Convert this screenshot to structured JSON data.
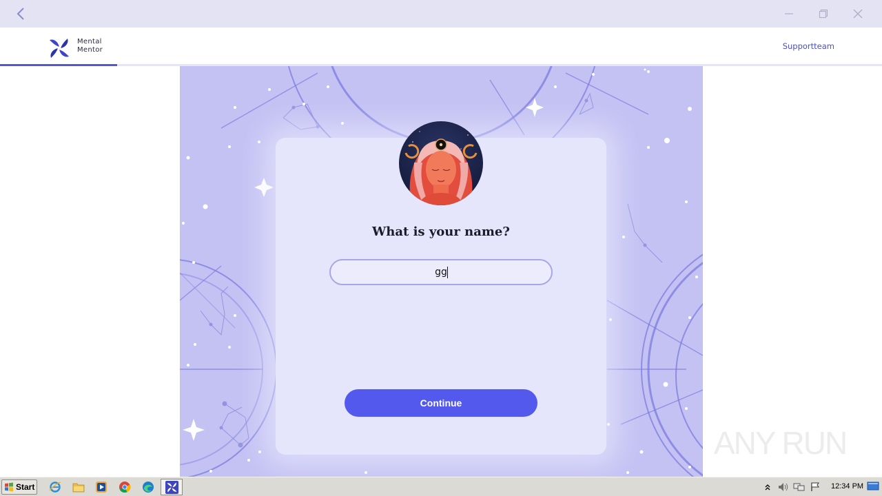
{
  "window": {
    "icons": {
      "back": "chevron-left-icon",
      "minimize": "minimize-icon",
      "restore": "restore-icon",
      "close": "close-icon"
    }
  },
  "header": {
    "brand_line1": "Mental",
    "brand_line2": "Mentor",
    "support_label": "Supportteam",
    "progress_fraction": 0.133,
    "accent_color": "#5457d1"
  },
  "onboarding": {
    "question": "What is your name?",
    "name_value": "gg",
    "continue_label": "Continue",
    "button_color": "#5459ee",
    "background_color": "#c4c2f3",
    "card_color": "#e5e5fb"
  },
  "watermark": {
    "text": "ANY RUN"
  },
  "taskbar": {
    "start_label": "Start",
    "pinned": [
      "internet-explorer-icon",
      "file-explorer-icon",
      "media-player-icon",
      "chrome-icon",
      "edge-icon",
      "mental-mentor-app-icon"
    ],
    "tray": [
      "show-hidden-icons-icon",
      "volume-icon",
      "network-icon",
      "action-center-flag-icon"
    ],
    "clock": "12:34 PM"
  }
}
